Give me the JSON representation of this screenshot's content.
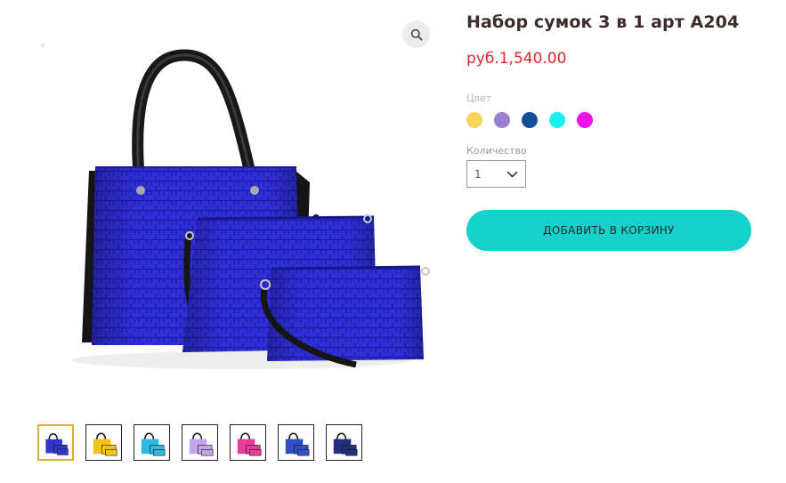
{
  "product": {
    "title": "Набор сумок 3 в 1 арт A204",
    "price": "руб.1,540.00"
  },
  "options": {
    "color_label": "Цвет",
    "colors": [
      "#f7d35b",
      "#9a7fd0",
      "#124f96",
      "#18f1f0",
      "#f20fe9"
    ],
    "quantity_label": "Количество",
    "quantity_value": "1"
  },
  "actions": {
    "add_to_cart_label": "ДОБАВИТЬ В КОРЗИНУ"
  },
  "gallery": {
    "main_image": "blue-handbag-set",
    "thumbnails": [
      {
        "name": "blue-bag-set",
        "color": "#2f36c9"
      },
      {
        "name": "yellow-bag-set",
        "color": "#f2c21a"
      },
      {
        "name": "cyan-bag-set",
        "color": "#30b8e0"
      },
      {
        "name": "lilac-bag-set",
        "color": "#c3a4e8"
      },
      {
        "name": "pink-bag-set",
        "color": "#e83d97"
      },
      {
        "name": "blue-bag-set-alt",
        "color": "#2f4fc4"
      },
      {
        "name": "navy-bag-detail",
        "color": "#24307a"
      }
    ]
  }
}
